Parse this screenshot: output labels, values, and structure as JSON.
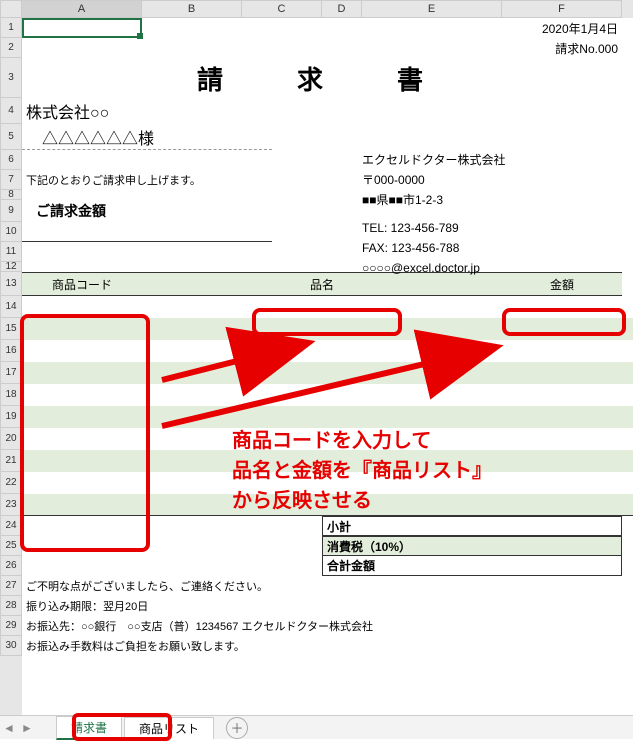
{
  "columns": [
    "A",
    "B",
    "C",
    "D",
    "E",
    "F"
  ],
  "row_numbers": [
    1,
    2,
    3,
    4,
    5,
    6,
    7,
    8,
    9,
    10,
    11,
    12,
    13,
    14,
    15,
    16,
    17,
    18,
    19,
    20,
    21,
    22,
    23,
    24,
    25,
    26,
    27,
    28,
    29,
    30
  ],
  "doc": {
    "date": "2020年1月4日",
    "invoice_no": "請求No.000",
    "title": "請　求　書",
    "client_company": "株式会社○○",
    "client_person": "△△△△△△様",
    "intro": "下記のとおりご請求申し上げます。",
    "amount_label": "ご請求金額",
    "sender": {
      "company": "エクセルドクター株式会社",
      "postal": "〒000-0000",
      "address": "■■県■■市1-2-3",
      "tel": "TEL: 123-456-789",
      "fax": "FAX: 123-456-788",
      "email": "○○○○@excel.doctor.jp"
    },
    "table_headers": {
      "code": "商品コード",
      "name": "品名",
      "amount": "金額"
    },
    "totals": {
      "subtotal": "小計",
      "tax": "消費税（10%）",
      "grand": "合計金額"
    },
    "notes": {
      "n1": "ご不明な点がございましたら、ご連絡ください。",
      "n2": "振り込み期限：翌月20日",
      "n3": "お振込先：○○銀行　○○支店（普）1234567 エクセルドクター株式会社",
      "n4": "お振込み手数料はご負担をお願い致します。"
    }
  },
  "tabs": {
    "active": "請求書",
    "other": "商品リスト"
  },
  "annotation": {
    "line1": "商品コードを入力して",
    "line2": "品名と金額を『商品リスト』",
    "line3": "から反映させる"
  }
}
